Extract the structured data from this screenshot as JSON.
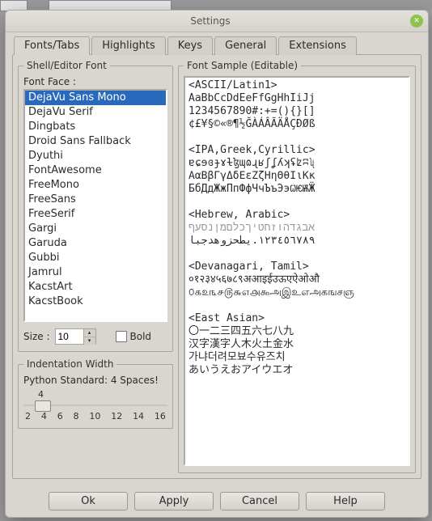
{
  "window": {
    "title": "Settings"
  },
  "tabs": {
    "items": [
      "Fonts/Tabs",
      "Highlights",
      "Keys",
      "General",
      "Extensions"
    ],
    "active_index": 0
  },
  "font_group": {
    "legend": "Shell/Editor Font",
    "face_label": "Font Face :",
    "faces": [
      "DejaVu Sans Mono",
      "DejaVu Serif",
      "Dingbats",
      "Droid Sans Fallback",
      "Dyuthi",
      "FontAwesome",
      "FreeMono",
      "FreeSans",
      "FreeSerif",
      "Gargi",
      "Garuda",
      "Gubbi",
      "Jamrul",
      "KacstArt",
      "KacstBook"
    ],
    "selected_index": 0,
    "size_label": "Size :",
    "size_value": "10",
    "bold_label": "Bold",
    "bold_checked": false
  },
  "indent_group": {
    "legend": "Indentation Width",
    "text": "Python Standard: 4 Spaces!",
    "value": "4",
    "ticks": [
      "2",
      "4",
      "6",
      "8",
      "10",
      "12",
      "14",
      "16"
    ]
  },
  "sample_group": {
    "legend": "Font Sample (Editable)"
  },
  "sample_lines": {
    "s1": "<ASCII/Latin1>",
    "s2": "AaBbCcDdEeFfGgHhIiJj",
    "s3": "1234567890#:+=(){}[]",
    "s4": "¢£¥§©«®¶½ĞÀÁÂÃÄÅÇÐØß",
    "s5": "",
    "s6": "<IPA,Greek,Cyrillic>",
    "s7": "ɐɕɘɞɟɤɫɮɰɷɻʁʃʆʎʞʢʫʭʯ",
    "s8": "ΑαΒβΓγΔδΕεΖζΗηΘθΙιΚκ",
    "s9": "БбДдЖжПпФфЧчЪъЭэѠѤѬӜ",
    "s10": "",
    "s11": "<Hebrew, Arabic>",
    "s12a": "אבגדהוזחטיךכלםמןנסעף",
    "s12b": "١٢٣٤٥٦٧٨٩.يطحزوهدجبا",
    "s13": "",
    "s14": "<Devanagari, Tamil>",
    "s15": "०१२३४५६७८९अआइईउऊएऐओऔ",
    "s16": "௦௧௨௩௪௫௬௭௮௯அஇஉஎஅகஙசஞ",
    "s17": "",
    "s18": "<East Asian>",
    "s19": "〇一二三四五六七八九",
    "s20": "汉字漢字人木火土金水",
    "s21": "가냐더려모뵤수유즈치",
    "s22": "あいうえおアイウエオ"
  },
  "buttons": {
    "ok": "Ok",
    "apply": "Apply",
    "cancel": "Cancel",
    "help": "Help"
  }
}
